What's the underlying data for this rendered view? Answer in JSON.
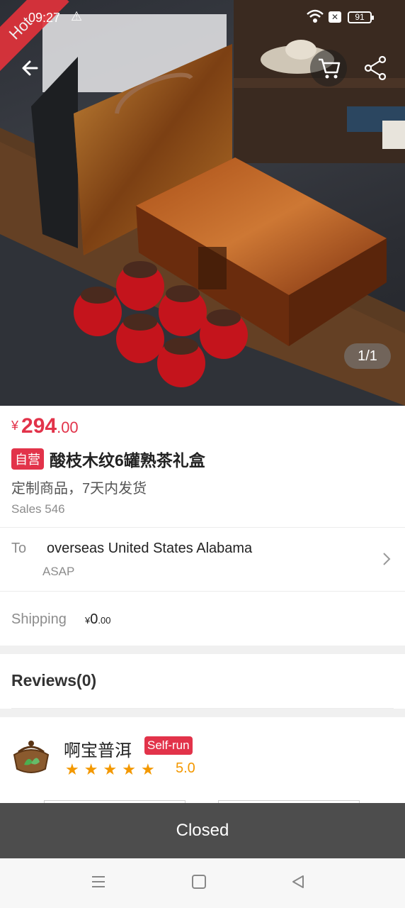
{
  "status_bar": {
    "time": "09:27",
    "battery": "91"
  },
  "hero": {
    "ribbon": "Hot",
    "pager": "1/1"
  },
  "product": {
    "price_currency": "¥",
    "price_int": "294",
    "price_dec": ".00",
    "badge": "自营",
    "title": "酸枝木纹6罐熟茶礼盒",
    "subtitle": "定制商品，7天内发货",
    "sales": "Sales 546"
  },
  "ship_to": {
    "label": "To",
    "address": "overseas United States Alabama",
    "eta": "ASAP"
  },
  "shipping": {
    "label": "Shipping",
    "currency": "¥",
    "int": "0",
    "dec": ".00"
  },
  "reviews": {
    "title": "Reviews(0)"
  },
  "shop": {
    "name": "啊宝普洱",
    "badge": "Self-run",
    "stars": [
      "★",
      "★",
      "★",
      "★",
      "★"
    ],
    "rating": "5.0"
  },
  "footer": {
    "closed_label": "Closed"
  },
  "colors": {
    "accent": "#e2334a",
    "star": "#f39800",
    "closed_bar": "#4d4d4d"
  }
}
